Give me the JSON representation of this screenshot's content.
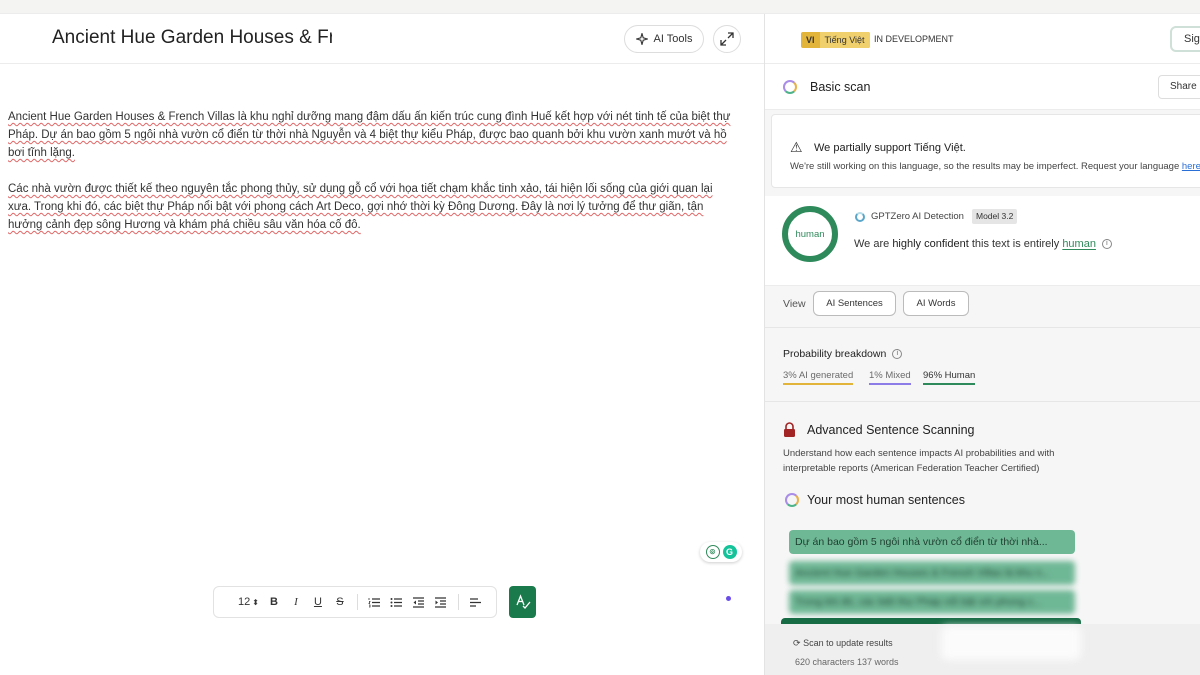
{
  "editor": {
    "title": "Ancient Hue Garden Houses & French Villas",
    "ai_tools_label": "AI Tools",
    "paragraphs": [
      "Ancient Hue Garden Houses & French Villas là khu nghỉ dưỡng mang đậm dấu ấn kiến trúc cung đình Huế kết hợp với nét tinh tế của biệt thự Pháp. Dự án bao gồm 5 ngôi nhà vườn cổ điển từ thời nhà Nguyễn và 4 biệt thự kiểu Pháp, được bao quanh bởi khu vườn xanh mướt và hồ bơi tĩnh lặng.",
      "Các nhà vườn được thiết kế theo nguyên tắc phong thủy, sử dụng gỗ cổ với họa tiết chạm khắc tinh xảo, tái hiện lối sống của giới quan lại xưa. Trong khi đó, các biệt thự Pháp nổi bật với phong cách Art Deco, gợi nhớ thời kỳ Đông Dương. Đây là nơi lý tưởng để thư giãn, tận hưởng cảnh đẹp sông Hương và khám phá chiều sâu văn hóa cố đô."
    ],
    "toolbar": {
      "font_size": "12",
      "bold": "B",
      "italic": "I",
      "underline": "U",
      "strike": "S"
    }
  },
  "panel": {
    "lang_code": "VI",
    "lang_name": "Tiếng Việt",
    "dev_status": "IN DEVELOPMENT",
    "sign_label": "Sign",
    "scan_title": "Basic scan",
    "share_label": "Share",
    "warning": {
      "title": "We partially support Tiếng Việt.",
      "desc": "We're still working on this language, so the results may be imperfect. Request your language ",
      "link": "here"
    },
    "result": {
      "ring_label": "human",
      "detector": "GPTZero AI Detection",
      "model": "Model 3.2",
      "verdict_pre": "We are ",
      "verdict_strong": "highly confident",
      "verdict_mid": " this text is entirely ",
      "verdict_human": "human"
    },
    "view": {
      "label": "View",
      "ai_sentences": "AI Sentences",
      "ai_words": "AI Words"
    },
    "probability": {
      "title": "Probability breakdown",
      "ai": "3% AI generated",
      "mixed": "1% Mixed",
      "human": "96% Human"
    },
    "advanced": {
      "title": "Advanced Sentence Scanning",
      "desc": "Understand how each sentence impacts AI probabilities and with interpretable reports (American Federation Teacher Certified)",
      "most_human": "Your most human sentences"
    },
    "sentences": [
      "Dự án bao gồm 5 ngôi nhà vườn cổ điển từ thời nhà...",
      "Ancient Hue Garden Houses & French Villas là khu n...",
      "Trong khi đó, các biệt thự Pháp nổi bật với phong c..."
    ],
    "footer": {
      "scan": "Scan to update results",
      "count": "620 characters 137 words"
    },
    "colors": {
      "human_green": "#2f8a5b",
      "ai_color": "#e2b43a",
      "mixed_color": "#8b7ce8",
      "lang_badge": "#e2b43a"
    }
  }
}
